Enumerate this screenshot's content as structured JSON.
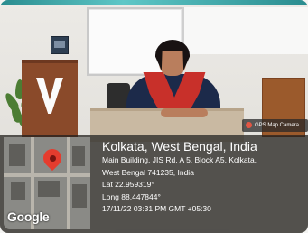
{
  "badge": {
    "label": "GPS Map Camera"
  },
  "map": {
    "brand": "Google",
    "pin_icon": "location-pin-icon"
  },
  "location": {
    "place": "Kolkata, West Bengal, India",
    "address_line1": "Main Building, JIS Rd, A 5, Block A5, Kolkata,",
    "address_line2": "West Bengal 741235, India",
    "latitude": "Lat 22.959319°",
    "longitude": "Long 88.447844°",
    "timestamp": "17/11/22 03:31 PM GMT +05:30"
  },
  "colors": {
    "pin": "#e53c2e",
    "overlay": "#1e1e1e",
    "text": "#ffffff"
  }
}
